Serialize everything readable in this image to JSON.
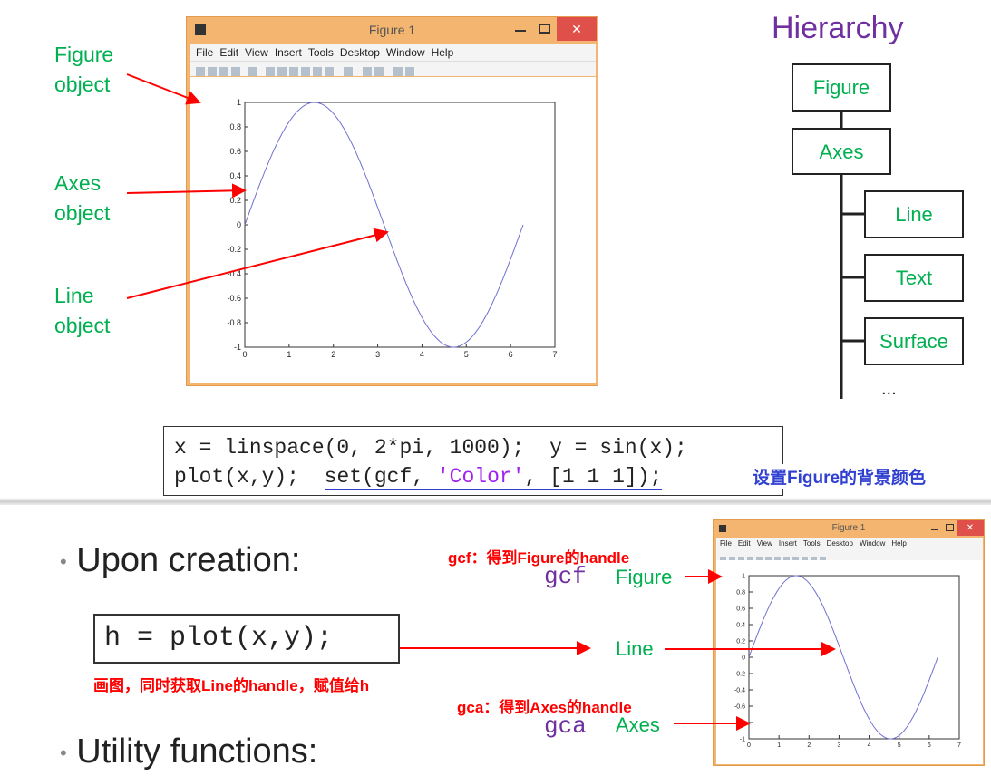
{
  "top_slide": {
    "annotations": [
      {
        "text": "Figure\nobject"
      },
      {
        "text": "Axes\nobject"
      },
      {
        "text": "Line\nobject"
      }
    ],
    "figure_window": {
      "title": "Figure 1",
      "close_label": "✕",
      "menu": [
        "File",
        "Edit",
        "View",
        "Insert",
        "Tools",
        "Desktop",
        "Window",
        "Help"
      ]
    },
    "hierarchy": {
      "title": "Hierarchy",
      "nodes": [
        "Figure",
        "Axes",
        "Line",
        "Text",
        "Surface"
      ],
      "more": "..."
    },
    "code": {
      "line1": "x = linspace(0, 2*pi, 1000);  y = sin(x);",
      "line2_a": "plot(x,y);  ",
      "line2_b": "set(gcf, ",
      "line2_c": "'Color'",
      "line2_d": ", [1 1 1]);",
      "note": "设置Figure的背景颜色"
    }
  },
  "bottom_slide": {
    "bullets": [
      "Upon creation:",
      "Utility functions:"
    ],
    "code": "h = plot(x,y);",
    "code_note": "画图，同时获取Line的handle，赋值给h",
    "gcf_note": "gcf：得到Figure的handle",
    "gcf": "gcf",
    "gcf_target": "Figure",
    "line_target": "Line",
    "gca_note": "gca：得到Axes的handle",
    "gca": "gca",
    "gca_target": "Axes",
    "figure_window": {
      "title": "Figure 1",
      "close_label": "✕",
      "menu": [
        "File",
        "Edit",
        "View",
        "Insert",
        "Tools",
        "Desktop",
        "Window",
        "Help"
      ]
    }
  },
  "chart_data": [
    {
      "type": "line",
      "series": [
        {
          "function": "y = sin(x)",
          "x_range": [
            0,
            6.2832
          ],
          "points": 1000
        }
      ],
      "xlim": [
        0,
        7
      ],
      "ylim": [
        -1,
        1
      ],
      "xticks": [
        0,
        1,
        2,
        3,
        4,
        5,
        6,
        7
      ],
      "yticks": [
        -1,
        -0.8,
        -0.6,
        -0.4,
        -0.2,
        0,
        0.2,
        0.4,
        0.6,
        0.8,
        1
      ],
      "line_color": "#7070d0"
    },
    {
      "type": "line",
      "series": [
        {
          "function": "y = sin(x)",
          "x_range": [
            0,
            6.2832
          ],
          "points": 1000
        }
      ],
      "xlim": [
        0,
        7
      ],
      "ylim": [
        -1,
        1
      ],
      "xticks": [
        0,
        1,
        2,
        3,
        4,
        5,
        6,
        7
      ],
      "yticks": [
        -1,
        -0.8,
        -0.6,
        -0.4,
        -0.2,
        0,
        0.2,
        0.4,
        0.6,
        0.8,
        1
      ],
      "line_color": "#7070d0"
    }
  ],
  "colors": {
    "green": "#00b050",
    "red": "#ff0000",
    "purple": "#7030a0",
    "note_blue": "#3040d0",
    "window_orange": "#f3b56f"
  }
}
